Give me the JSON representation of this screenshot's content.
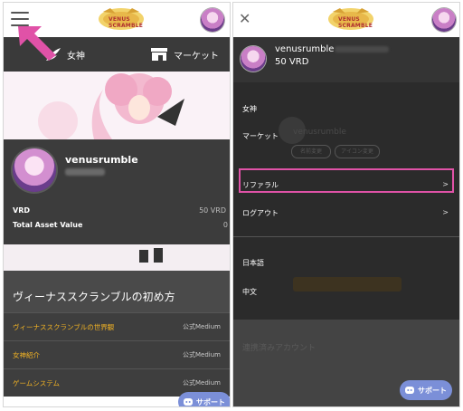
{
  "left": {
    "nav": {
      "goddess_label": "女神",
      "market_label": "マーケット"
    },
    "profile": {
      "username": "venusrumble",
      "vrd_label": "VRD",
      "vrd_value": "50 VRD",
      "asset_label": "Total Asset Value",
      "asset_value": "0"
    },
    "section_title": "ヴィーナススクランブルの初め方",
    "articles": [
      {
        "title": "ヴィーナススクランブルの世界観",
        "source": "公式Medium"
      },
      {
        "title": "女神紹介",
        "source": "公式Medium"
      },
      {
        "title": "ゲームシステム",
        "source": "公式Medium"
      }
    ],
    "support_label": "サポート"
  },
  "right": {
    "user": {
      "username": "venusrumble",
      "balance": "50 VRD"
    },
    "menu": {
      "goddess": "女神",
      "market": "マーケット",
      "referral": "リファラル",
      "logout": "ログアウト",
      "lang_ja": "日本語",
      "lang_zh": "中文",
      "chevron": ">"
    },
    "ghost": {
      "username": "venusrumble",
      "pill1": "名前変更",
      "pill2": "アイコン変更",
      "linked": "連携済みアカウント"
    },
    "support_label": "サポート"
  },
  "colors": {
    "accent_pink": "#e052a7",
    "article_orange": "#f2b324",
    "support_blue": "#7b8fd8"
  }
}
